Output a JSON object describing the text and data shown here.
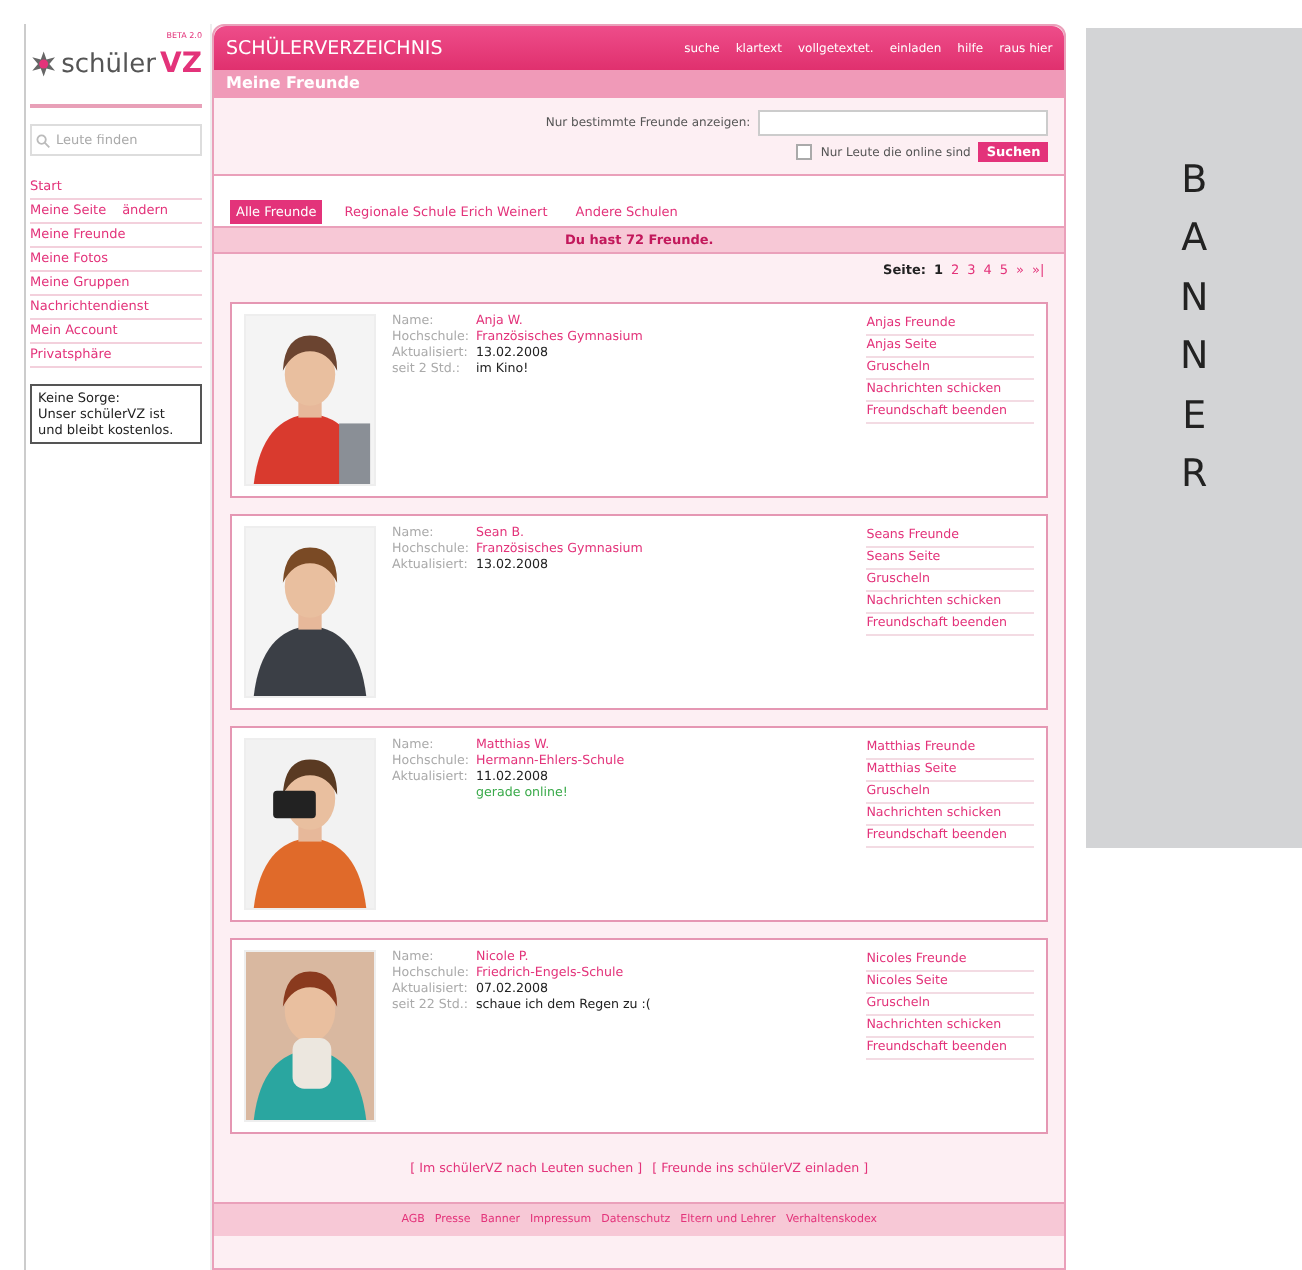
{
  "logo": {
    "word": "schüler",
    "mark": "VZ",
    "badge": "BETA 2.0"
  },
  "sidebar": {
    "search": {
      "placeholder": "Leute finden"
    },
    "items": [
      {
        "label": "Start"
      },
      {
        "label": "Meine Seite",
        "extra": "ändern"
      },
      {
        "label": "Meine Freunde"
      },
      {
        "label": "Meine Fotos"
      },
      {
        "label": "Meine Gruppen"
      },
      {
        "label": "Nachrichtendienst"
      },
      {
        "label": "Mein Account"
      },
      {
        "label": "Privatsphäre"
      }
    ],
    "notice": [
      "Keine Sorge:",
      "Unser schülerVZ ist",
      "und bleibt kostenlos."
    ]
  },
  "header": {
    "title": "SCHÜLERVERZEICHNIS",
    "links": [
      "suche",
      "klartext",
      "vollgetextet.",
      "einladen",
      "hilfe",
      "raus hier"
    ],
    "page_title": "Meine Freunde"
  },
  "filter": {
    "label": "Nur bestimmte Freunde anzeigen:",
    "online_only": {
      "label": "Nur Leute die online sind",
      "checked": false
    },
    "button": "Suchen"
  },
  "tabs": [
    {
      "label": "Alle Freunde",
      "selected": true
    },
    {
      "label": "Regionale Schule Erich Weinert",
      "selected": false
    },
    {
      "label": "Andere Schulen",
      "selected": false
    }
  ],
  "count": "Du hast 72 Freunde.",
  "pagination": {
    "label": "Seite:",
    "pages": [
      {
        "label": "1",
        "selected": true
      },
      {
        "label": "2",
        "selected": false
      },
      {
        "label": "3",
        "selected": false
      },
      {
        "label": "4",
        "selected": false
      },
      {
        "label": "5",
        "selected": false
      }
    ],
    "next": "»",
    "last": "»|"
  },
  "friends": [
    {
      "photo": {
        "kind": "picture"
      },
      "fields": [
        {
          "label": "Name:",
          "value": "Anja W.",
          "kind": "link"
        },
        {
          "label": "Hochschule:",
          "value": "Französisches Gymnasium",
          "kind": "link"
        },
        {
          "label": "Aktualisiert:",
          "value": "13.02.2008",
          "kind": "text"
        },
        {
          "label": "seit 2 Std.:",
          "value": "im Kino!",
          "kind": "text"
        }
      ],
      "actions": [
        "Anjas Freunde",
        "Anjas Seite",
        "Gruscheln",
        "Nachrichten schicken",
        "Freundschaft beenden"
      ]
    },
    {
      "photo": {
        "kind": "picture"
      },
      "fields": [
        {
          "label": "Name:",
          "value": "Sean B.",
          "kind": "link"
        },
        {
          "label": "Hochschule:",
          "value": "Französisches Gymnasium",
          "kind": "link"
        },
        {
          "label": "Aktualisiert:",
          "value": "13.02.2008",
          "kind": "text"
        }
      ],
      "actions": [
        "Seans Freunde",
        "Seans Seite",
        "Gruscheln",
        "Nachrichten schicken",
        "Freundschaft beenden"
      ]
    },
    {
      "photo": {
        "kind": "picture"
      },
      "fields": [
        {
          "label": "Name:",
          "value": "Matthias W.",
          "kind": "link"
        },
        {
          "label": "Hochschule:",
          "value": "Hermann-Ehlers-Schule",
          "kind": "link"
        },
        {
          "label": "Aktualisiert:",
          "value": "11.02.2008",
          "kind": "text"
        },
        {
          "value": "gerade online!",
          "kind": "online"
        }
      ],
      "actions": [
        "Matthias Freunde",
        "Matthias Seite",
        "Gruscheln",
        "Nachrichten schicken",
        "Freundschaft beenden"
      ]
    },
    {
      "photo": {
        "kind": "picture"
      },
      "fields": [
        {
          "label": "Name:",
          "value": "Nicole P.",
          "kind": "link"
        },
        {
          "label": "Hochschule:",
          "value": "Friedrich-Engels-Schule",
          "kind": "link"
        },
        {
          "label": "Aktualisiert:",
          "value": "07.02.2008",
          "kind": "text"
        },
        {
          "label": "seit 22 Std.:",
          "value": "schaue ich dem Regen zu :(",
          "kind": "text"
        }
      ],
      "actions": [
        "Nicoles Freunde",
        "Nicoles Seite",
        "Gruscheln",
        "Nachrichten schicken",
        "Freundschaft beenden"
      ]
    }
  ],
  "bottom_links": [
    "[ Im schülerVZ nach Leuten suchen ]",
    "[ Freunde ins schülerVZ einladen ]"
  ],
  "footer": [
    "AGB",
    "Presse",
    "Banner",
    "Impressum",
    "Datenschutz",
    "Eltern und Lehrer",
    "Verhaltenskodex"
  ],
  "banner": {
    "text": "BANNER"
  }
}
